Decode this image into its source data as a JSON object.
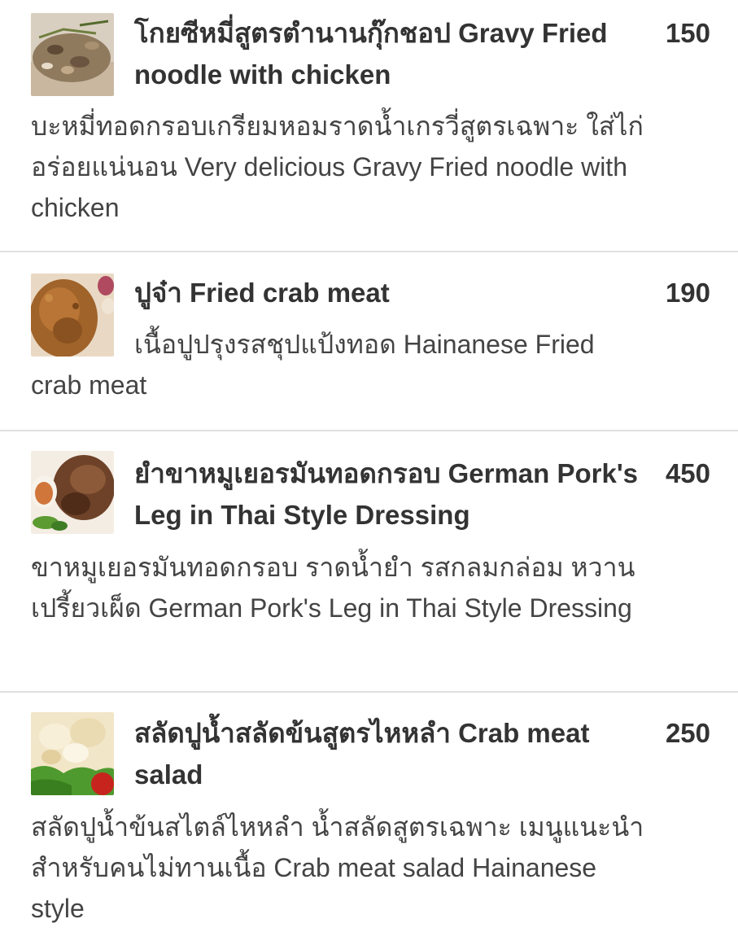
{
  "menu": {
    "items": [
      {
        "title": "โกยซีหมี่สูตรตำนานกุ๊กชอป Gravy Fried noodle with chicken",
        "price": "150",
        "description": "บะหมี่ทอดกรอบเกรียมหอมราดน้ำเกรวี่สูตรเฉพาะ ใส่ไก่ อร่อยแน่นอน Very delicious Gravy Fried noodle with chicken",
        "image": "gravy-fried-noodle-photo"
      },
      {
        "title": "ปูจ๋า Fried crab meat",
        "price": "190",
        "description": "เนื้อปูปรุงรสชุปแป้งทอด Hainanese Fried crab meat",
        "image": "fried-crab-meat-photo"
      },
      {
        "title": "ยำขาหมูเยอรมันทอดกรอบ German Pork's Leg in Thai Style Dressing",
        "price": "450",
        "description": "ขาหมูเยอรมันทอดกรอบ ราดน้ำยำ รสกลมกล่อม หวานเปรี้ยวเผ็ด German Pork's Leg in Thai Style Dressing",
        "image": "german-pork-leg-photo"
      },
      {
        "title": "สลัดปูน้ำสลัดข้นสูตรไหหลำ Crab meat salad",
        "price": "250",
        "description": "สลัดปูน้ำข้นสไตล์ไหหลำ น้ำสลัดสูตรเฉพาะ เมนูแนะนำสำหรับคนไม่ทานเนื้อ Crab meat salad Hainanese style",
        "image": "crab-meat-salad-photo"
      }
    ]
  },
  "colors": {
    "text": "#333333",
    "divider": "#e0e0e0",
    "background": "#ffffff"
  }
}
